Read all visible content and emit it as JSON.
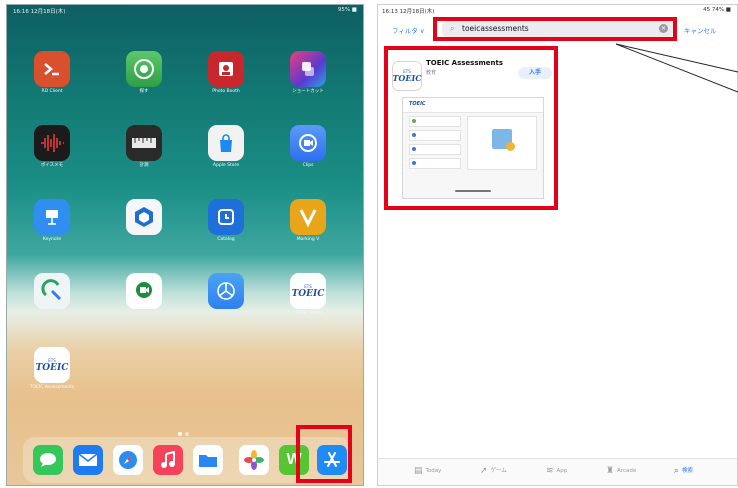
{
  "home": {
    "status_left": "16:16 12月18日(木)",
    "status_right": "95% ■",
    "apps": [
      {
        "label": "RD Client",
        "icon": "rd-client-icon",
        "color": "#d9502e"
      },
      {
        "label": "探す",
        "icon": "find-my-icon",
        "color": "#35b04f"
      },
      {
        "label": "Photo Booth",
        "icon": "photo-booth-icon",
        "color": "#c7272d"
      },
      {
        "label": "ショートカット",
        "icon": "shortcuts-icon",
        "color": "#5a3ad1"
      },
      {
        "label": "ボイスメモ",
        "icon": "voice-memos-icon",
        "color": "#1b1b1b"
      },
      {
        "label": "計測",
        "icon": "measure-icon",
        "color": "#2a2a2a"
      },
      {
        "label": "Apple Store",
        "icon": "apple-store-icon",
        "color": "#f2f2f2"
      },
      {
        "label": "Clips",
        "icon": "clips-icon",
        "color": "#2f6ff0"
      },
      {
        "label": "Keynote",
        "icon": "keynote-icon",
        "color": "#2f8ef0"
      },
      {
        "label": "",
        "icon": "hexagon-app-icon",
        "color": "#f4f6f8"
      },
      {
        "label": "Catalog",
        "icon": "catalog-icon",
        "color": "#1e6fd9"
      },
      {
        "label": "Marking V",
        "icon": "marking-icon",
        "color": "#e9a51a"
      },
      {
        "label": "",
        "icon": "ring-app-icon",
        "color": "#eef5f4"
      },
      {
        "label": "",
        "icon": "meet-icon",
        "color": "#1e8e3e"
      },
      {
        "label": "",
        "icon": "testflight-icon",
        "color": "#2f80ed"
      },
      {
        "label": "TOEIC Tests",
        "icon": "toeic-tests-icon",
        "color": "#ffffff"
      },
      {
        "label": "TOEIC Assessments",
        "icon": "toeic-assessments-icon",
        "color": "#ffffff"
      }
    ],
    "toeic_text": "TOEIC",
    "ets_text": "ETS",
    "dock": [
      {
        "icon": "messages-icon",
        "color": "#35c759"
      },
      {
        "icon": "mail-icon",
        "color": "#1e7cf2"
      },
      {
        "icon": "safari-icon",
        "color": "#2d8cf0"
      },
      {
        "icon": "music-icon",
        "color": "#f5425a"
      },
      {
        "icon": "files-icon",
        "color": "#2a86f0"
      },
      {
        "icon": "photos-icon",
        "color": "#ffffff"
      },
      {
        "icon": "word-icon",
        "color": "#55c533"
      },
      {
        "icon": "app-store-icon",
        "color": "#1f8cf5"
      }
    ],
    "word_letter": "W"
  },
  "store": {
    "status_left": "16:13 12月18日(木)",
    "status_right": "45 74% ■",
    "filter_label": "フィルタ ∨",
    "search_value": "toeicassessments",
    "cancel_label": "キャンセル",
    "result": {
      "title": "TOEIC Assessments",
      "subtitle": "教育",
      "get_label": "入手",
      "preview_logo": "TOEIC"
    },
    "tabs": [
      {
        "label": "Today",
        "icon": "today-icon"
      },
      {
        "label": "ゲーム",
        "icon": "games-icon"
      },
      {
        "label": "App",
        "icon": "apps-icon"
      },
      {
        "label": "Arcade",
        "icon": "arcade-icon"
      },
      {
        "label": "検索",
        "icon": "search-tab-icon",
        "active": true
      }
    ]
  },
  "colors": {
    "highlight": "#e4021a",
    "accent": "#2f7cf6"
  }
}
